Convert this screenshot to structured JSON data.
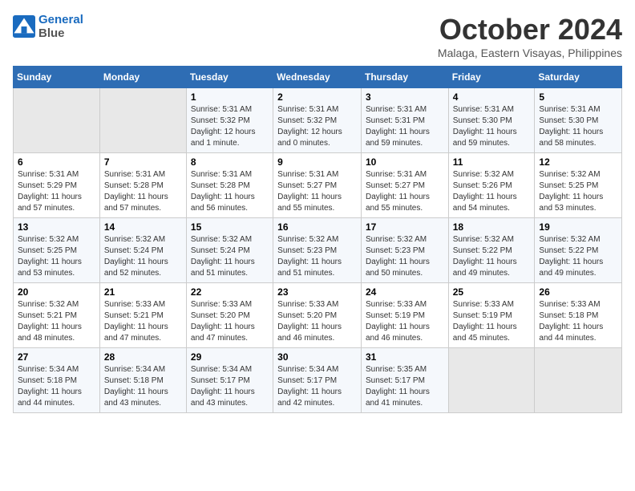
{
  "header": {
    "logo_line1": "General",
    "logo_line2": "Blue",
    "month_title": "October 2024",
    "location": "Malaga, Eastern Visayas, Philippines"
  },
  "days_of_week": [
    "Sunday",
    "Monday",
    "Tuesday",
    "Wednesday",
    "Thursday",
    "Friday",
    "Saturday"
  ],
  "weeks": [
    [
      {
        "day": "",
        "info": ""
      },
      {
        "day": "",
        "info": ""
      },
      {
        "day": "1",
        "info": "Sunrise: 5:31 AM\nSunset: 5:32 PM\nDaylight: 12 hours\nand 1 minute."
      },
      {
        "day": "2",
        "info": "Sunrise: 5:31 AM\nSunset: 5:32 PM\nDaylight: 12 hours\nand 0 minutes."
      },
      {
        "day": "3",
        "info": "Sunrise: 5:31 AM\nSunset: 5:31 PM\nDaylight: 11 hours\nand 59 minutes."
      },
      {
        "day": "4",
        "info": "Sunrise: 5:31 AM\nSunset: 5:30 PM\nDaylight: 11 hours\nand 59 minutes."
      },
      {
        "day": "5",
        "info": "Sunrise: 5:31 AM\nSunset: 5:30 PM\nDaylight: 11 hours\nand 58 minutes."
      }
    ],
    [
      {
        "day": "6",
        "info": "Sunrise: 5:31 AM\nSunset: 5:29 PM\nDaylight: 11 hours\nand 57 minutes."
      },
      {
        "day": "7",
        "info": "Sunrise: 5:31 AM\nSunset: 5:28 PM\nDaylight: 11 hours\nand 57 minutes."
      },
      {
        "day": "8",
        "info": "Sunrise: 5:31 AM\nSunset: 5:28 PM\nDaylight: 11 hours\nand 56 minutes."
      },
      {
        "day": "9",
        "info": "Sunrise: 5:31 AM\nSunset: 5:27 PM\nDaylight: 11 hours\nand 55 minutes."
      },
      {
        "day": "10",
        "info": "Sunrise: 5:31 AM\nSunset: 5:27 PM\nDaylight: 11 hours\nand 55 minutes."
      },
      {
        "day": "11",
        "info": "Sunrise: 5:32 AM\nSunset: 5:26 PM\nDaylight: 11 hours\nand 54 minutes."
      },
      {
        "day": "12",
        "info": "Sunrise: 5:32 AM\nSunset: 5:25 PM\nDaylight: 11 hours\nand 53 minutes."
      }
    ],
    [
      {
        "day": "13",
        "info": "Sunrise: 5:32 AM\nSunset: 5:25 PM\nDaylight: 11 hours\nand 53 minutes."
      },
      {
        "day": "14",
        "info": "Sunrise: 5:32 AM\nSunset: 5:24 PM\nDaylight: 11 hours\nand 52 minutes."
      },
      {
        "day": "15",
        "info": "Sunrise: 5:32 AM\nSunset: 5:24 PM\nDaylight: 11 hours\nand 51 minutes."
      },
      {
        "day": "16",
        "info": "Sunrise: 5:32 AM\nSunset: 5:23 PM\nDaylight: 11 hours\nand 51 minutes."
      },
      {
        "day": "17",
        "info": "Sunrise: 5:32 AM\nSunset: 5:23 PM\nDaylight: 11 hours\nand 50 minutes."
      },
      {
        "day": "18",
        "info": "Sunrise: 5:32 AM\nSunset: 5:22 PM\nDaylight: 11 hours\nand 49 minutes."
      },
      {
        "day": "19",
        "info": "Sunrise: 5:32 AM\nSunset: 5:22 PM\nDaylight: 11 hours\nand 49 minutes."
      }
    ],
    [
      {
        "day": "20",
        "info": "Sunrise: 5:32 AM\nSunset: 5:21 PM\nDaylight: 11 hours\nand 48 minutes."
      },
      {
        "day": "21",
        "info": "Sunrise: 5:33 AM\nSunset: 5:21 PM\nDaylight: 11 hours\nand 47 minutes."
      },
      {
        "day": "22",
        "info": "Sunrise: 5:33 AM\nSunset: 5:20 PM\nDaylight: 11 hours\nand 47 minutes."
      },
      {
        "day": "23",
        "info": "Sunrise: 5:33 AM\nSunset: 5:20 PM\nDaylight: 11 hours\nand 46 minutes."
      },
      {
        "day": "24",
        "info": "Sunrise: 5:33 AM\nSunset: 5:19 PM\nDaylight: 11 hours\nand 46 minutes."
      },
      {
        "day": "25",
        "info": "Sunrise: 5:33 AM\nSunset: 5:19 PM\nDaylight: 11 hours\nand 45 minutes."
      },
      {
        "day": "26",
        "info": "Sunrise: 5:33 AM\nSunset: 5:18 PM\nDaylight: 11 hours\nand 44 minutes."
      }
    ],
    [
      {
        "day": "27",
        "info": "Sunrise: 5:34 AM\nSunset: 5:18 PM\nDaylight: 11 hours\nand 44 minutes."
      },
      {
        "day": "28",
        "info": "Sunrise: 5:34 AM\nSunset: 5:18 PM\nDaylight: 11 hours\nand 43 minutes."
      },
      {
        "day": "29",
        "info": "Sunrise: 5:34 AM\nSunset: 5:17 PM\nDaylight: 11 hours\nand 43 minutes."
      },
      {
        "day": "30",
        "info": "Sunrise: 5:34 AM\nSunset: 5:17 PM\nDaylight: 11 hours\nand 42 minutes."
      },
      {
        "day": "31",
        "info": "Sunrise: 5:35 AM\nSunset: 5:17 PM\nDaylight: 11 hours\nand 41 minutes."
      },
      {
        "day": "",
        "info": ""
      },
      {
        "day": "",
        "info": ""
      }
    ]
  ]
}
